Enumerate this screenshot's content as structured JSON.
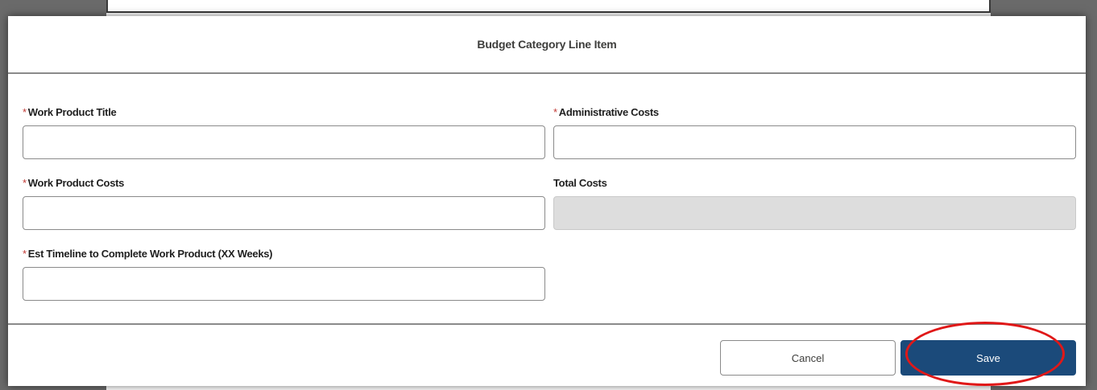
{
  "modal": {
    "title": "Budget Category Line Item"
  },
  "form": {
    "required_marker": "*",
    "work_product_title": {
      "label": "Work Product Title",
      "value": "",
      "required": true
    },
    "administrative_costs": {
      "label": "Administrative Costs",
      "value": "",
      "required": true
    },
    "work_product_costs": {
      "label": "Work Product Costs",
      "value": "",
      "required": true
    },
    "total_costs": {
      "label": "Total Costs",
      "value": "",
      "required": false,
      "readonly": true
    },
    "est_timeline": {
      "label": "Est Timeline to Complete Work Product (XX Weeks)",
      "value": "",
      "required": true
    }
  },
  "footer": {
    "cancel_label": "Cancel",
    "save_label": "Save"
  },
  "colors": {
    "save_button": "#1b4a7a",
    "required_marker": "#c23934",
    "highlight_ring": "#e01818",
    "readonly_field": "#dddddd"
  }
}
